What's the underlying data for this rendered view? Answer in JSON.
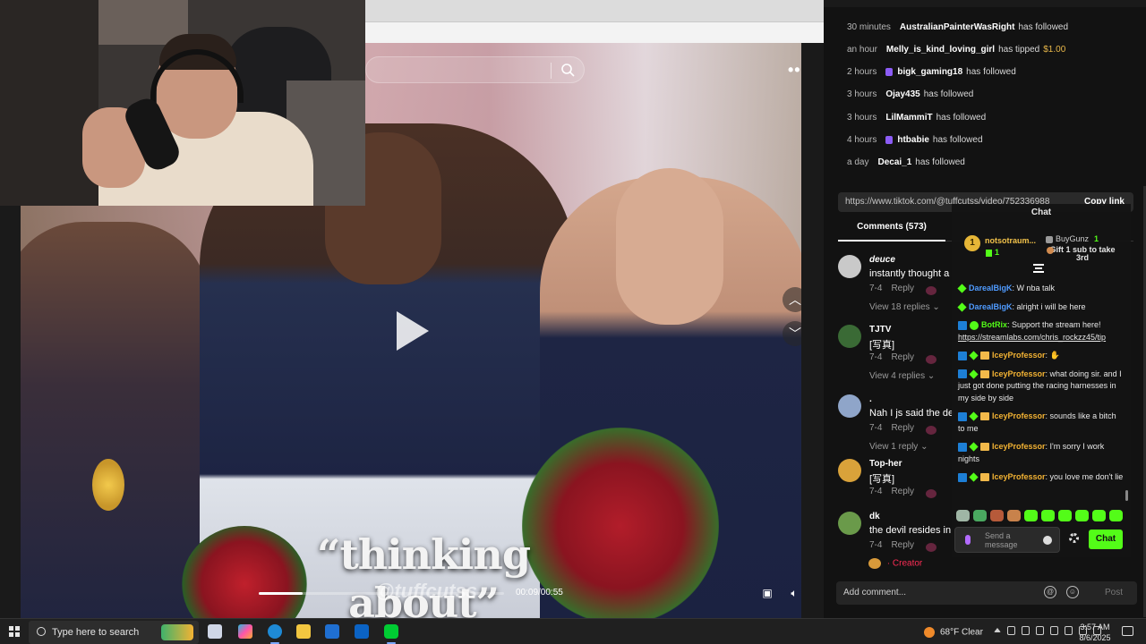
{
  "activity": [
    {
      "time": "30 minutes",
      "user": "AustralianPainterWasRight",
      "action": "has followed",
      "badge": false
    },
    {
      "time": "an hour",
      "user": "Melly_is_kind_loving_girl",
      "action": "has tipped",
      "amount": "$1.00",
      "badge": false
    },
    {
      "time": "2 hours",
      "user": "bigk_gaming18",
      "action": "has followed",
      "badge": true
    },
    {
      "time": "3 hours",
      "user": "Ojay435",
      "action": "has followed",
      "badge": false
    },
    {
      "time": "3 hours",
      "user": "LilMammiT",
      "action": "has followed",
      "badge": false
    },
    {
      "time": "4 hours",
      "user": "htbabie",
      "action": "has followed",
      "badge": true
    },
    {
      "time": "a day",
      "user": "Decai_1",
      "action": "has followed",
      "badge": false
    }
  ],
  "video": {
    "caption": "“thinking about”",
    "watermark": "@tuffcutss",
    "timecode": "00:09/00:55",
    "progress": 0.18
  },
  "share": {
    "url": "https://www.tiktok.com/@tuffcutss/video/752336988",
    "copy_label": "Copy link"
  },
  "comments_tab": "Comments (573)",
  "comments": [
    {
      "name": "deuce",
      "text": "instantly thought a",
      "date": "7-4",
      "reply": "Reply",
      "view": "View 18 replies ⌄",
      "avatar_color": "#c9c9c9"
    },
    {
      "name": "TJTV",
      "text": "[写真]",
      "date": "7-4",
      "reply": "Reply",
      "view": "View 4 replies ⌄",
      "avatar_color": "#3a6a35"
    },
    {
      "name": ".",
      "text": "Nah I js said the de",
      "date": "7-4",
      "reply": "Reply",
      "view": "View 1 reply ⌄",
      "avatar_color": "#8fa5c9"
    },
    {
      "name": "Top-her",
      "text": "[写真]",
      "date": "7-4",
      "reply": "Reply",
      "view": "",
      "avatar_color": "#d9a23a"
    },
    {
      "name": "dk",
      "text": "the devil resides in",
      "date": "7-4",
      "reply": "Reply",
      "view": "",
      "avatar_color": "#6a9a4a"
    }
  ],
  "creator_label": "· Creator",
  "add_comment": {
    "placeholder": "Add comment...",
    "post": "Post"
  },
  "chat": {
    "title": "Chat",
    "leader": {
      "rank": "1",
      "name": "notsotraum...",
      "gifts": "1"
    },
    "runner": {
      "name": "BuyGunz",
      "gifts": "1",
      "promo": "Gift 1 sub to take 3rd"
    },
    "messages": [
      {
        "user": "DarealBigK",
        "user_color": "blue",
        "badges": [
          "kick"
        ],
        "text": ": W nba talk"
      },
      {
        "user": "DarealBigK",
        "user_color": "blue",
        "badges": [
          "kick"
        ],
        "text": ": alright i will be here"
      },
      {
        "user": "BotRix",
        "user_color": "green",
        "badges": [
          "mod",
          "ver"
        ],
        "text": ": Support the stream here!",
        "link": "https://streamlabs.com/chris_rockzz45/tip"
      },
      {
        "user": "IceyProfessor",
        "user_color": "gold",
        "badges": [
          "mod",
          "kick",
          "gift"
        ],
        "text": ": ✋"
      },
      {
        "user": "IceyProfessor",
        "user_color": "gold",
        "badges": [
          "mod",
          "kick",
          "gift"
        ],
        "text": ": what doing sir. and I just got done putting the racing harnesses in my side by side"
      },
      {
        "user": "IceyProfessor",
        "user_color": "gold",
        "badges": [
          "mod",
          "kick",
          "gift"
        ],
        "text": ": sounds like a bitch to me"
      },
      {
        "user": "IceyProfessor",
        "user_color": "gold",
        "badges": [
          "mod",
          "kick",
          "gift"
        ],
        "text": ": I'm sorry I work nights"
      },
      {
        "user": "IceyProfessor",
        "user_color": "gold",
        "badges": [
          "mod",
          "kick",
          "gift"
        ],
        "text": ": you love me don't lie"
      }
    ],
    "input_placeholder": "Send a message",
    "send_label": "Chat"
  },
  "taskbar": {
    "search_placeholder": "Type here to search",
    "weather": "68°F  Clear",
    "time": "3:57 AM",
    "date": "8/6/2025"
  }
}
